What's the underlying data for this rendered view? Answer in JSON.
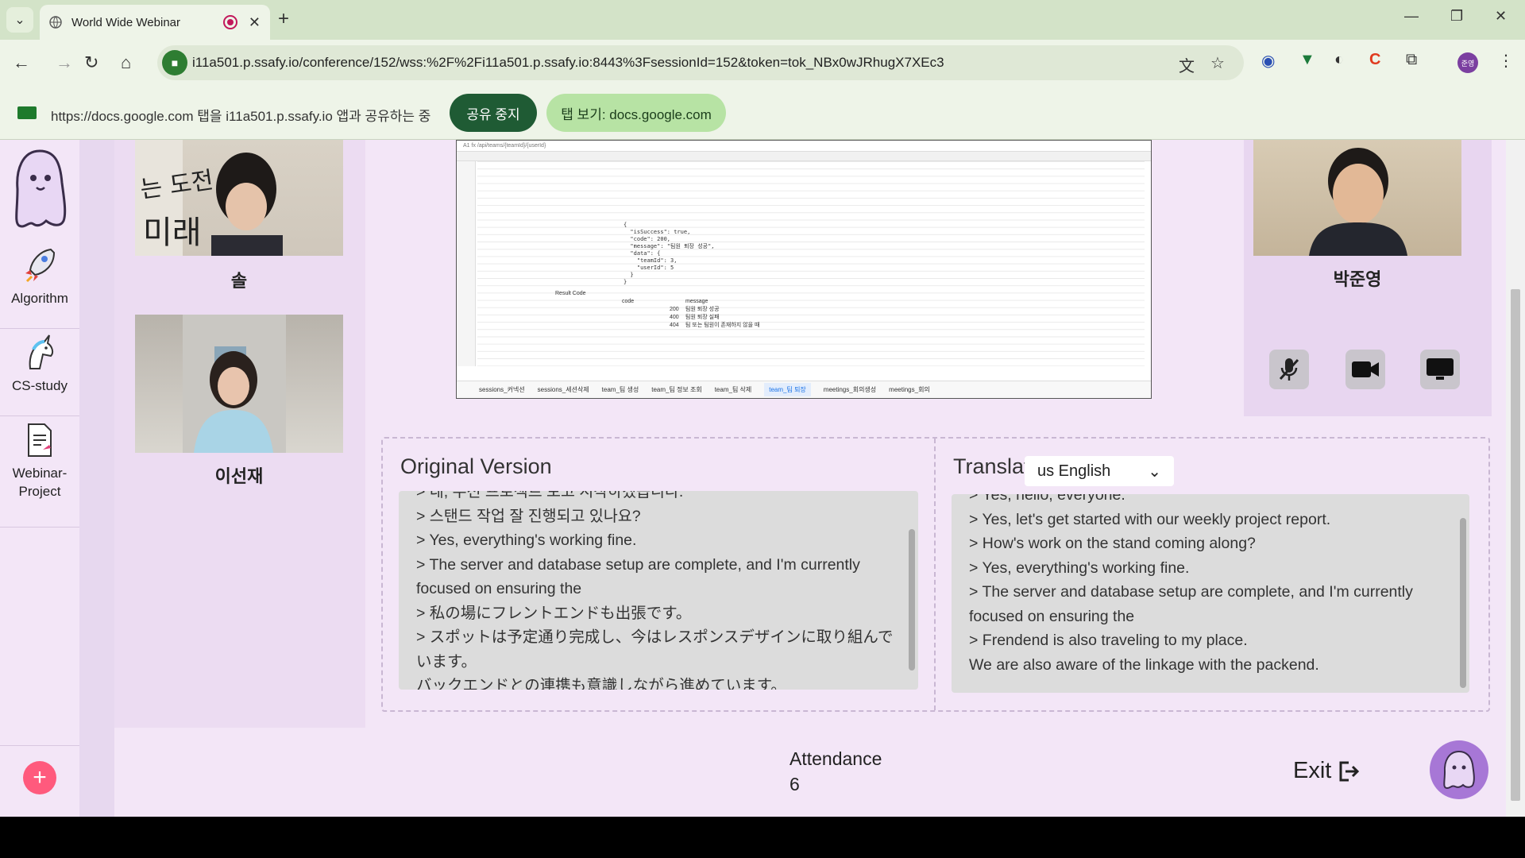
{
  "browser": {
    "tab_title": "World Wide Webinar",
    "url": "i11a501.p.ssafy.io/conference/152/wss:%2F%2Fi11a501.p.ssafy.io:8443%3FsessionId=152&token=tok_NBx0wJRhugX7XEc3",
    "profile_initials": "준영"
  },
  "share_bar": {
    "message": "https://docs.google.com 탭을 i11a501.p.ssafy.io 앱과 공유하는 중",
    "stop_label": "공유 중지",
    "view_label": "탭 보기: docs.google.com"
  },
  "nav": {
    "items": [
      {
        "label": "Algorithm",
        "icon": "rocket-icon"
      },
      {
        "label": "CS-study",
        "icon": "unicorn-icon"
      },
      {
        "label": "Webinar-\nProject",
        "icon": "document-icon"
      }
    ],
    "add_label": "+"
  },
  "participants": [
    {
      "name": "솔"
    },
    {
      "name": "이선재"
    },
    {
      "name": "박준영"
    }
  ],
  "shared_sheet": {
    "formula_bar": "A1   fx  /api/teams/{teamId}/{userId}",
    "json_text": "{\n  \"isSuccess\": true,\n  \"code\": 200,\n  \"message\": \"팀원 퇴장 성공\",\n  \"data\": {\n    \"teamId\": 3,\n    \"userId\": 5\n  }\n}",
    "result_code_label": "Result Code",
    "code_header": "code",
    "message_header": "message",
    "rows": [
      {
        "code": "200",
        "message": "팀원 퇴장 성공"
      },
      {
        "code": "400",
        "message": "팀원 퇴장 실패"
      },
      {
        "code": "404",
        "message": "팀 또는 팀원이 존재하지 않을 때"
      }
    ],
    "sheet_tabs": [
      "sessions_커넥션",
      "sessions_세션삭제",
      "team_팀 생성",
      "team_팀 정보 조회",
      "team_팀 삭제",
      "team_팀 퇴장",
      "meetings_회의생성",
      "meetings_회의"
    ],
    "active_tab": 5
  },
  "translation": {
    "original_title": "Original Version",
    "translated_title": "Translated Version",
    "language": "us  English",
    "original_lines": [
      "> 네, 우선 프로젝트 보고 시작하겠습니다.",
      "> 스탠드 작업 잘 진행되고 있나요?",
      "> Yes, everything's working fine.",
      "> The server and database setup are complete, and I'm currently focused on ensuring the",
      "> 私の場にフレントエンドも出張です。",
      "> スポットは予定通り完成し、今はレスポンスデザインに取り組んでいます。",
      "バックエンドとの連携も意識しながら進めています。"
    ],
    "translated_lines": [
      "> Yes, hello, everyone.",
      "> Yes, let's get started with our weekly project report.",
      "> How's work on the stand coming along?",
      "> Yes, everything's working fine.",
      "> The server and database setup are complete, and I'm currently focused on ensuring the",
      "> Frendend is also traveling to my place.",
      "We are also aware of the linkage with the packend."
    ]
  },
  "footer": {
    "attendance_label": "Attendance",
    "attendance_count": "6",
    "exit_label": "Exit"
  },
  "colors": {
    "accent_purple": "#a777d6",
    "add_button": "#ff5a7d",
    "share_stop": "#1f5b34",
    "share_view": "#b7e3a4"
  }
}
